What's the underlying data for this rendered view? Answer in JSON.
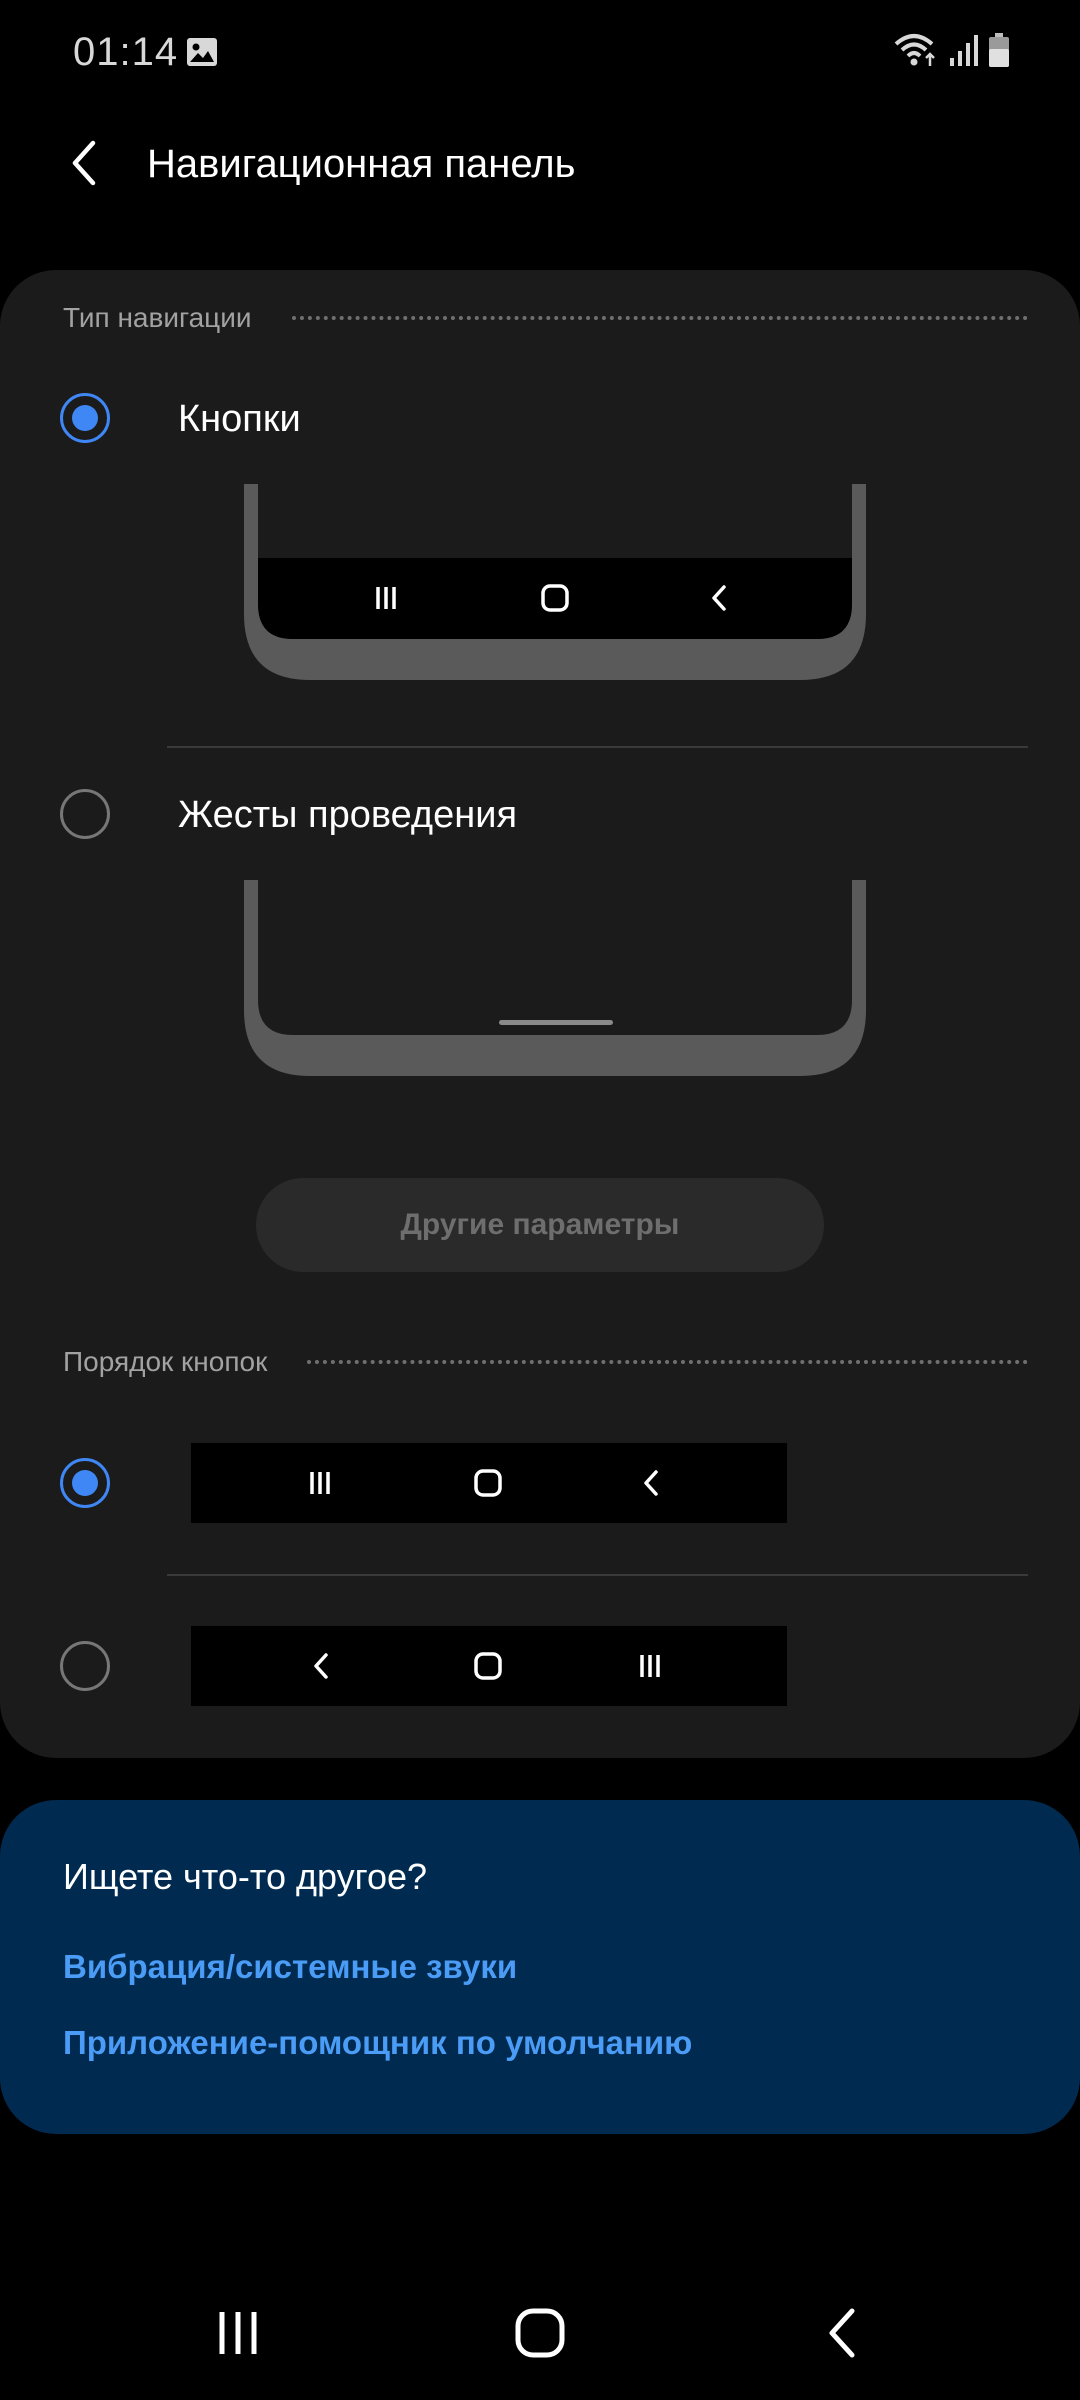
{
  "status_bar": {
    "time": "01:14",
    "icons": [
      "gallery-icon",
      "wifi-icon",
      "signal-icon",
      "battery-icon"
    ]
  },
  "header": {
    "back_icon": "back-arrow-icon",
    "title": "Навигационная панель"
  },
  "navigation_type": {
    "section_title": "Тип навигации",
    "options": [
      {
        "label": "Кнопки",
        "selected": true,
        "preview": "buttons"
      },
      {
        "label": "Жесты проведения",
        "selected": false,
        "preview": "gestures"
      }
    ],
    "more_button_label": "Другие параметры"
  },
  "button_order": {
    "section_title": "Порядок кнопок",
    "options": [
      {
        "selected": true,
        "buttons": [
          "recents-icon",
          "home-icon",
          "back-icon"
        ]
      },
      {
        "selected": false,
        "buttons": [
          "back-icon",
          "home-icon",
          "recents-icon"
        ]
      }
    ]
  },
  "suggestions": {
    "title": "Ищете что-то другое?",
    "links": [
      "Вибрация/системные звуки",
      "Приложение-помощник по умолчанию"
    ]
  },
  "system_nav": {
    "buttons": [
      "recents-icon",
      "home-icon",
      "back-icon"
    ]
  },
  "colors": {
    "accent": "#3f87f5",
    "card_background": "#1b1b1b",
    "suggest_background": "#002a4f",
    "link": "#4a9cf6"
  }
}
